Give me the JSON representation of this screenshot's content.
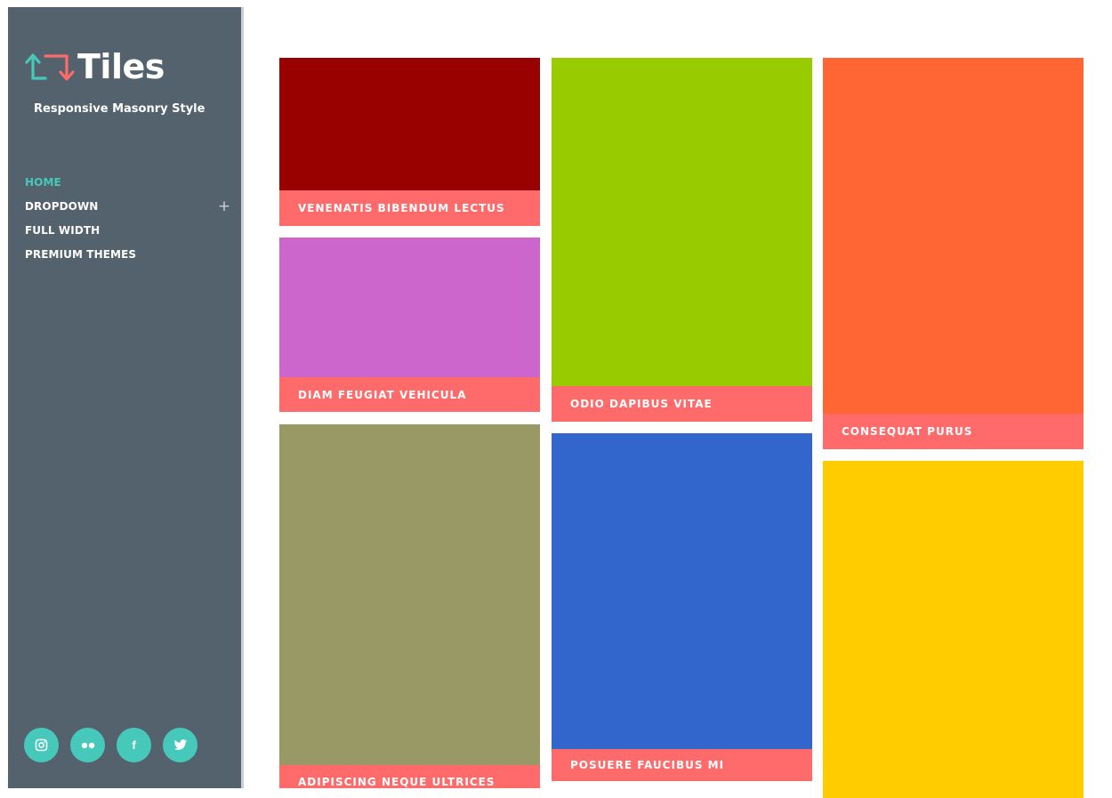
{
  "brand": {
    "title": "Tiles",
    "tagline": "Responsive Masonry Style",
    "arrow_up_color": "#46c8ba",
    "arrow_down_color": "#ff6b6b"
  },
  "nav": {
    "items": [
      {
        "label": "HOME",
        "active": true
      },
      {
        "label": "DROPDOWN",
        "expand_icon": "+"
      },
      {
        "label": "FULL WIDTH"
      },
      {
        "label": "PREMIUM THEMES"
      }
    ]
  },
  "social": [
    {
      "icon": "instagram-icon"
    },
    {
      "icon": "flickr-icon"
    },
    {
      "icon": "facebook-icon",
      "glyph": "f"
    },
    {
      "icon": "twitter-icon"
    }
  ],
  "tiles": [
    {
      "caption": "VENENATIS BIBENDUM LECTUS",
      "color": "#990000"
    },
    {
      "caption": "DIAM FEUGIAT VEHICULA",
      "color": "#cc66cc"
    },
    {
      "caption": "ADIPISCING NEQUE ULTRICES",
      "color": "#999966"
    },
    {
      "caption": "ODIO DAPIBUS VITAE",
      "color": "#99cc00"
    },
    {
      "caption": "POSUERE FAUCIBUS MI",
      "color": "#3366cc"
    },
    {
      "caption": "CONSEQUAT PURUS",
      "color": "#ff6633"
    },
    {
      "caption": "",
      "color": "#ffcc00"
    }
  ],
  "theme": {
    "sidebar_bg": "#54626e",
    "accent": "#46c8ba",
    "caption_bg": "#ff6b6b"
  }
}
